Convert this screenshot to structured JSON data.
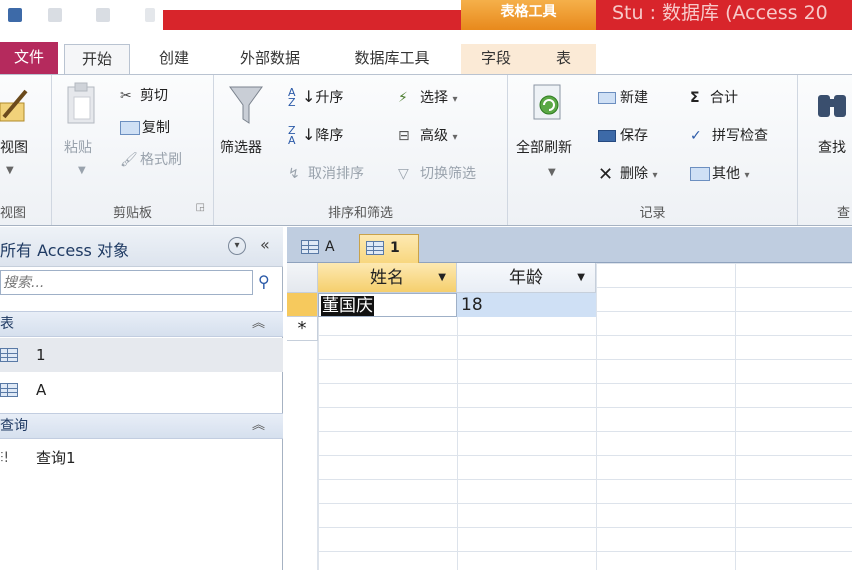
{
  "title": {
    "context_tab_group": "表格工具",
    "window_title": "Stu : 数据库 (Access 20"
  },
  "tabs": [
    "文件",
    "开始",
    "创建",
    "外部数据",
    "数据库工具",
    "字段",
    "表"
  ],
  "ribbon": {
    "views": {
      "label": "视图",
      "button": "视图"
    },
    "clipboard": {
      "label": "剪贴板",
      "paste": "粘贴",
      "cut": "剪切",
      "copy": "复制",
      "format_painter": "格式刷"
    },
    "sort_filter": {
      "label": "排序和筛选",
      "filter": "筛选器",
      "ascending": "升序",
      "descending": "降序",
      "remove_sort": "取消排序",
      "selection": "选择",
      "advanced": "高级",
      "toggle_filter": "切换筛选"
    },
    "records": {
      "label": "记录",
      "refresh_all": "全部刷新",
      "new": "新建",
      "save": "保存",
      "delete": "删除",
      "totals": "合计",
      "spelling": "拼写检查",
      "more": "其他"
    },
    "find": {
      "label": "查",
      "button": "查找"
    }
  },
  "nav": {
    "title": "所有 Access 对象",
    "search_placeholder": "搜索...",
    "sections": [
      {
        "name": "表",
        "items": [
          "1",
          "A"
        ]
      },
      {
        "name": "查询",
        "items": [
          "查询1"
        ]
      }
    ]
  },
  "doc_tabs": [
    "A",
    "1"
  ],
  "table": {
    "columns": [
      "姓名",
      "年龄"
    ],
    "rows": [
      {
        "name": "董国庆",
        "age": "18"
      }
    ],
    "new_row_marker": "*"
  }
}
